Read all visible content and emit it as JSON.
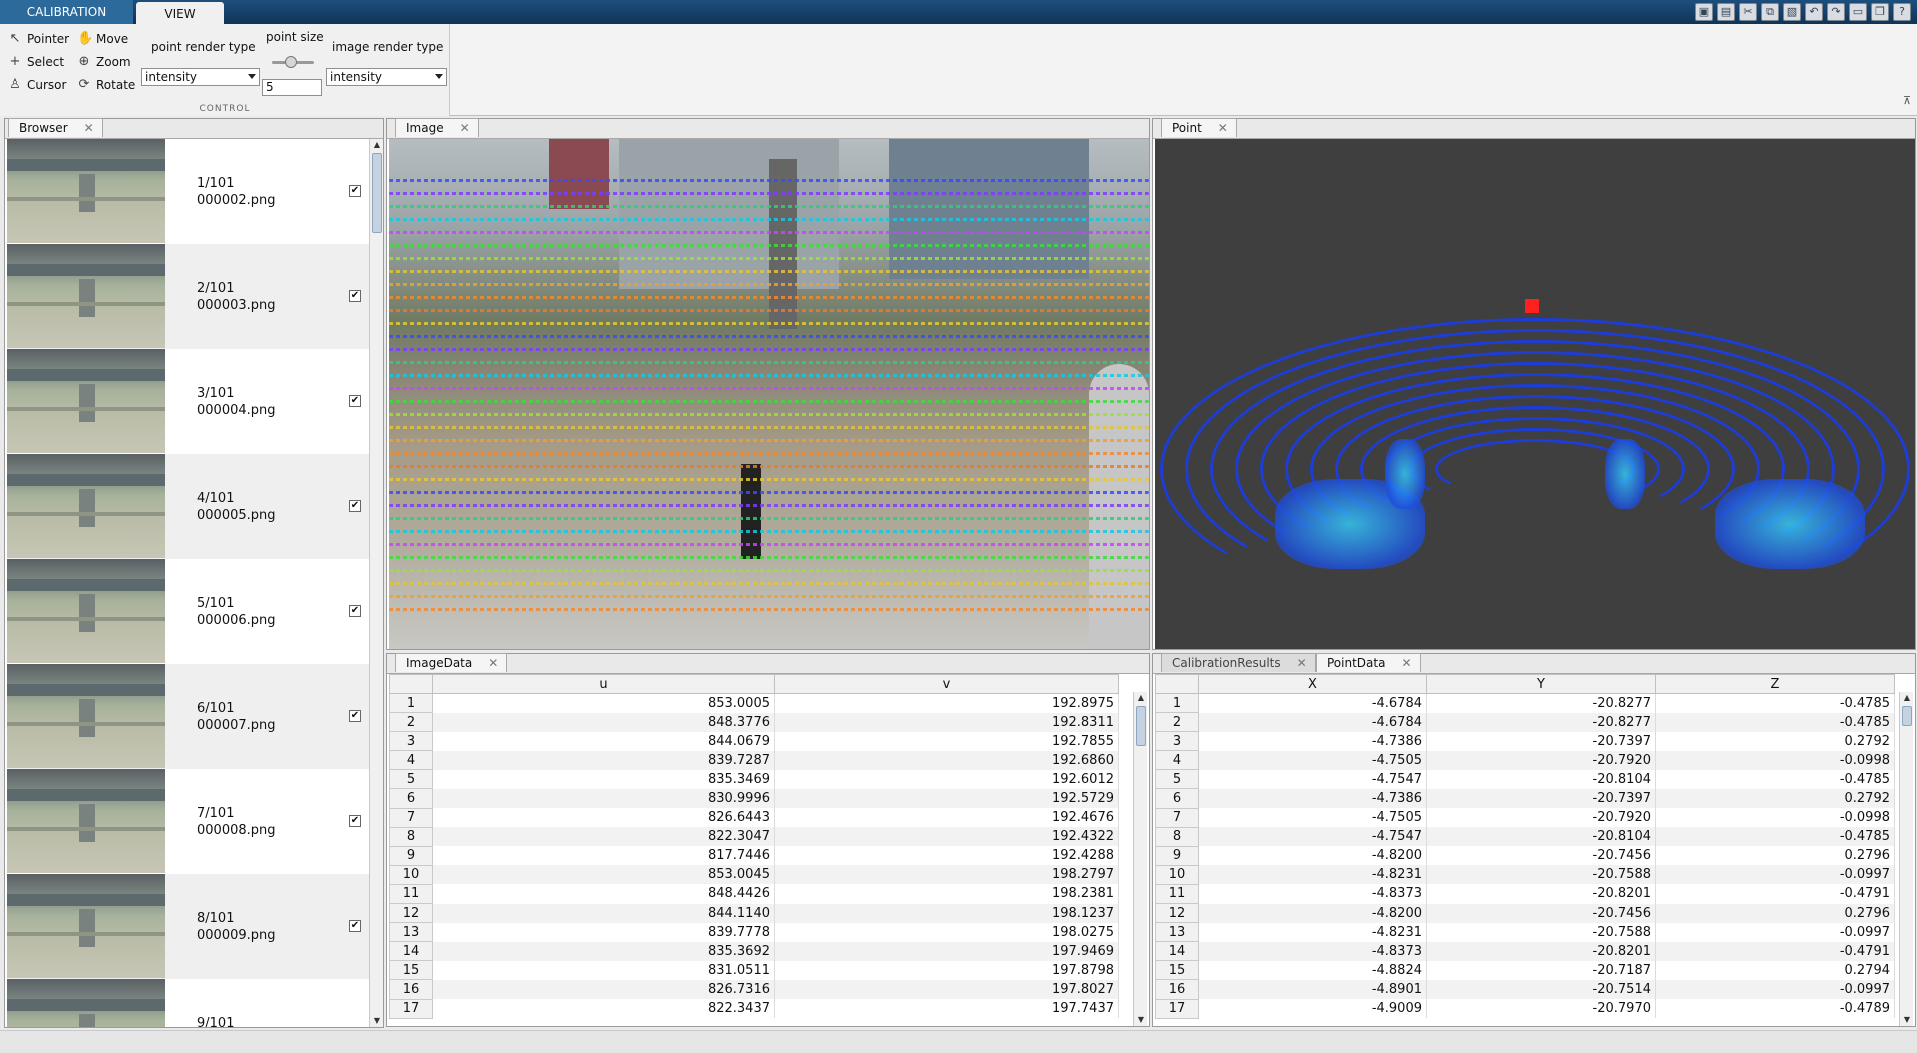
{
  "top_tabs": [
    "CALIBRATION",
    "VIEW"
  ],
  "quick_access_icons": [
    "save-icon",
    "save-all-icon",
    "cut-icon",
    "copy-icon",
    "paste-icon",
    "undo-icon",
    "redo-icon",
    "switch-windows-icon",
    "restore-icon",
    "help-icon"
  ],
  "control": {
    "tools": [
      {
        "label": "Pointer",
        "icon": "pointer-icon"
      },
      {
        "label": "Select",
        "icon": "select-icon"
      },
      {
        "label": "Cursor",
        "icon": "cursor-icon"
      },
      {
        "label": "Move",
        "icon": "hand-icon"
      },
      {
        "label": "Zoom",
        "icon": "zoom-icon"
      },
      {
        "label": "Rotate",
        "icon": "rotate-icon"
      }
    ],
    "point_render_type_label": "point render type",
    "point_render_type_value": "intensity",
    "point_size_label": "point size",
    "point_size_value": "5",
    "image_render_type_label": "image render type",
    "image_render_type_value": "intensity",
    "caption": "CONTROL"
  },
  "browser": {
    "tab": "Browser",
    "items": [
      {
        "index": "1/101",
        "file": "000002.png",
        "checked": true
      },
      {
        "index": "2/101",
        "file": "000003.png",
        "checked": true
      },
      {
        "index": "3/101",
        "file": "000004.png",
        "checked": true
      },
      {
        "index": "4/101",
        "file": "000005.png",
        "checked": true
      },
      {
        "index": "5/101",
        "file": "000006.png",
        "checked": true
      },
      {
        "index": "6/101",
        "file": "000007.png",
        "checked": true
      },
      {
        "index": "7/101",
        "file": "000008.png",
        "checked": true
      },
      {
        "index": "8/101",
        "file": "000009.png",
        "checked": true
      },
      {
        "index": "9/101",
        "file": "",
        "checked": false
      }
    ]
  },
  "image_panel": {
    "tab": "Image"
  },
  "point_panel": {
    "tab": "Point"
  },
  "image_data": {
    "tab": "ImageData",
    "columns": [
      "u",
      "v"
    ],
    "rows": [
      [
        "1",
        "853.0005",
        "192.8975"
      ],
      [
        "2",
        "848.3776",
        "192.8311"
      ],
      [
        "3",
        "844.0679",
        "192.7855"
      ],
      [
        "4",
        "839.7287",
        "192.6860"
      ],
      [
        "5",
        "835.3469",
        "192.6012"
      ],
      [
        "6",
        "830.9996",
        "192.5729"
      ],
      [
        "7",
        "826.6443",
        "192.4676"
      ],
      [
        "8",
        "822.3047",
        "192.4322"
      ],
      [
        "9",
        "817.7446",
        "192.4288"
      ],
      [
        "10",
        "853.0045",
        "198.2797"
      ],
      [
        "11",
        "848.4426",
        "198.2381"
      ],
      [
        "12",
        "844.1140",
        "198.1237"
      ],
      [
        "13",
        "839.7778",
        "198.0275"
      ],
      [
        "14",
        "835.3692",
        "197.9469"
      ],
      [
        "15",
        "831.0511",
        "197.8798"
      ],
      [
        "16",
        "826.7316",
        "197.8027"
      ],
      [
        "17",
        "822.3437",
        "197.7437"
      ]
    ]
  },
  "point_data": {
    "tabs": [
      "CalibrationResults",
      "PointData"
    ],
    "columns": [
      "X",
      "Y",
      "Z"
    ],
    "rows": [
      [
        "1",
        "-4.6784",
        "-20.8277",
        "-0.4785"
      ],
      [
        "2",
        "-4.6784",
        "-20.8277",
        "-0.4785"
      ],
      [
        "3",
        "-4.7386",
        "-20.7397",
        "0.2792"
      ],
      [
        "4",
        "-4.7505",
        "-20.7920",
        "-0.0998"
      ],
      [
        "5",
        "-4.7547",
        "-20.8104",
        "-0.4785"
      ],
      [
        "6",
        "-4.7386",
        "-20.7397",
        "0.2792"
      ],
      [
        "7",
        "-4.7505",
        "-20.7920",
        "-0.0998"
      ],
      [
        "8",
        "-4.7547",
        "-20.8104",
        "-0.4785"
      ],
      [
        "9",
        "-4.8200",
        "-20.7456",
        "0.2796"
      ],
      [
        "10",
        "-4.8231",
        "-20.7588",
        "-0.0997"
      ],
      [
        "11",
        "-4.8373",
        "-20.8201",
        "-0.4791"
      ],
      [
        "12",
        "-4.8200",
        "-20.7456",
        "0.2796"
      ],
      [
        "13",
        "-4.8231",
        "-20.7588",
        "-0.0997"
      ],
      [
        "14",
        "-4.8373",
        "-20.8201",
        "-0.4791"
      ],
      [
        "15",
        "-4.8824",
        "-20.7187",
        "0.2794"
      ],
      [
        "16",
        "-4.8901",
        "-20.7514",
        "-0.0997"
      ],
      [
        "17",
        "-4.9009",
        "-20.7970",
        "-0.4789"
      ]
    ]
  }
}
